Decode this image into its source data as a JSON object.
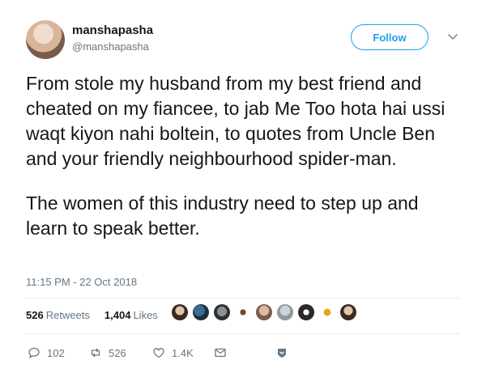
{
  "tweet": {
    "display_name": "manshapasha",
    "handle": "@manshapasha",
    "follow_label": "Follow",
    "paragraphs": [
      "From stole my husband from my best friend and cheated on my fiancee, to jab Me Too hota hai ussi waqt kiyon nahi boltein, to quotes from Uncle Ben and your friendly neighbourhood spider-man.",
      "The women of this industry need to step up and learn to speak better."
    ],
    "timestamp": "11:15 PM - 22 Oct 2018"
  },
  "stats": {
    "retweets_count": "526",
    "retweets_label": "Retweets",
    "likes_count": "1,404",
    "likes_label": "Likes"
  },
  "actions": {
    "reply_count": "102",
    "retweet_count": "526",
    "like_count": "1.4K"
  },
  "colors": {
    "accent": "#1da1f2",
    "text": "#14171a",
    "muted": "#657786"
  }
}
